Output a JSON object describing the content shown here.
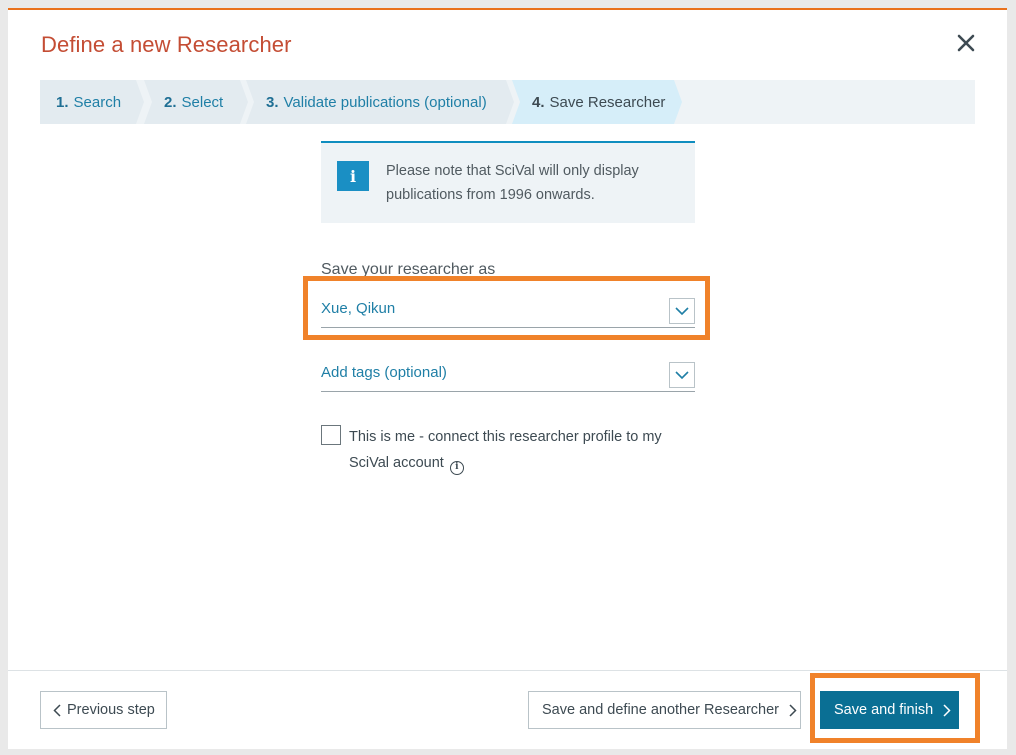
{
  "dialog": {
    "title": "Define a new Researcher"
  },
  "icons": {
    "close": "close-icon",
    "info": "info-icon",
    "chevron": "chevron-down-icon",
    "help": "help-icon"
  },
  "colors": {
    "accent_orange": "#f0822a",
    "title_red": "#c44d34",
    "primary_blue": "#0a6f94",
    "link_blue": "#1f7fa6"
  },
  "steps": [
    {
      "num": "1.",
      "label": "Search"
    },
    {
      "num": "2.",
      "label": "Select"
    },
    {
      "num": "3.",
      "label": "Validate publications (optional)"
    },
    {
      "num": "4.",
      "label": "Save Researcher",
      "active": true
    }
  ],
  "info": {
    "icon_glyph": "i",
    "text": "Please note that SciVal will only display publications from 1996 onwards."
  },
  "form": {
    "save_label": "Save your researcher as",
    "name_value": "Xue, Qikun",
    "tags_placeholder": "Add tags (optional)",
    "checkbox_label": "This is me - connect this researcher profile to my SciVal account",
    "help_glyph": "i"
  },
  "footer": {
    "prev_label": "Previous step",
    "another_label": "Save and define another Researcher",
    "finish_label": "Save and finish"
  }
}
